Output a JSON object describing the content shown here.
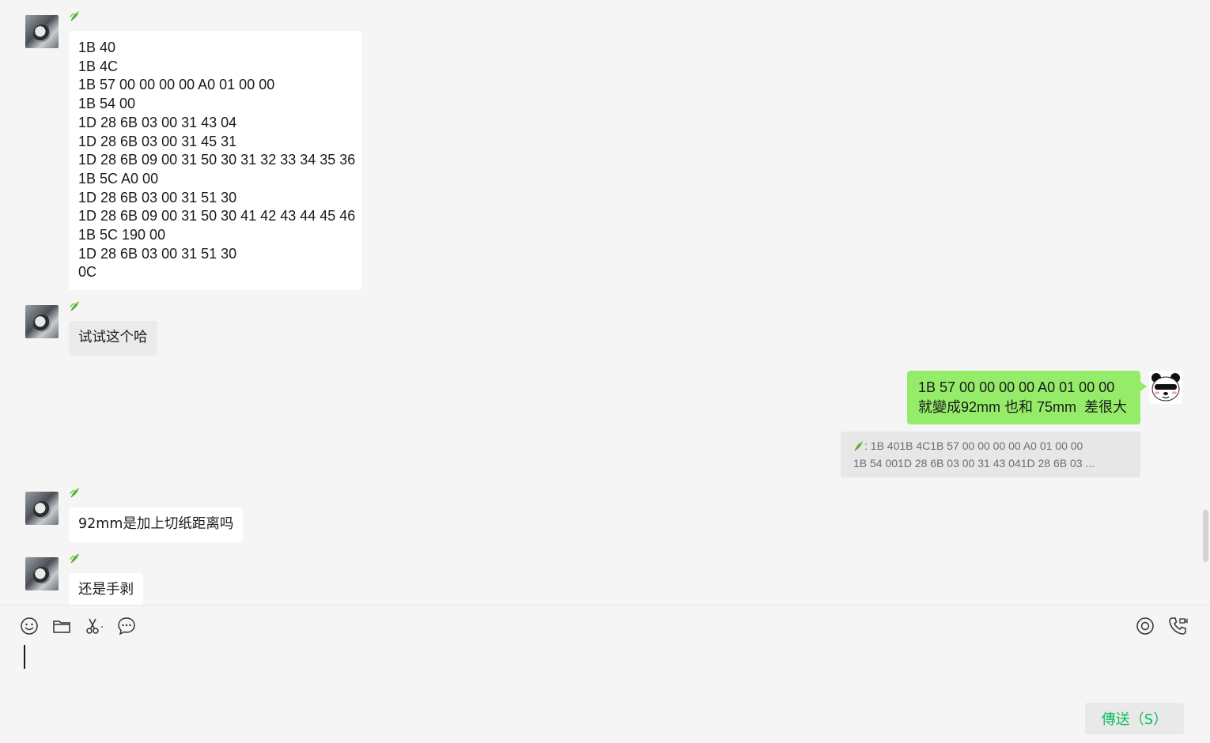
{
  "messages": [
    {
      "sender_icon": "leaf-icon",
      "text": "1B 40\n1B 4C\n1B 57 00 00 00 00 A0 01 00 00\n1B 54 00\n1D 28 6B 03 00 31 43 04\n1D 28 6B 03 00 31 45 31\n1D 28 6B 09 00 31 50 30 31 32 33 34 35 36\n1B 5C A0 00\n1D 28 6B 03 00 31 51 30\n1D 28 6B 09 00 31 50 30 41 42 43 44 45 46\n1B 5C 190 00\n1D 28 6B 03 00 31 51 30\n0C"
    },
    {
      "sender_icon": "leaf-icon",
      "text": "试试这个哈"
    },
    {
      "mine": true,
      "text": "1B 57 00 00 00 00 A0 01 00 00\n就變成92mm 也和 75mm  差很大",
      "quote": ": 1B 401B 4C1B 57 00 00 00 00 A0 01 00 00\n1B 54 001D 28 6B 03 00 31 43 041D 28 6B 03 ..."
    },
    {
      "sender_icon": "leaf-icon",
      "text": "92mm是加上切纸距离吗"
    },
    {
      "sender_icon": "leaf-icon",
      "text": "还是手剥"
    }
  ],
  "toolbar": {
    "left_icons": [
      "emoji-icon",
      "folder-icon",
      "scissors-icon",
      "chat-history-icon"
    ],
    "right_icons": [
      "live-icon",
      "call-icon"
    ]
  },
  "input": {
    "value": ""
  },
  "send_button": {
    "label": "傳送（S）"
  },
  "colors": {
    "mine_bubble": "#95ec69",
    "peer_bubble": "#ffffff",
    "accent": "#07c160",
    "background": "#f5f5f5"
  }
}
